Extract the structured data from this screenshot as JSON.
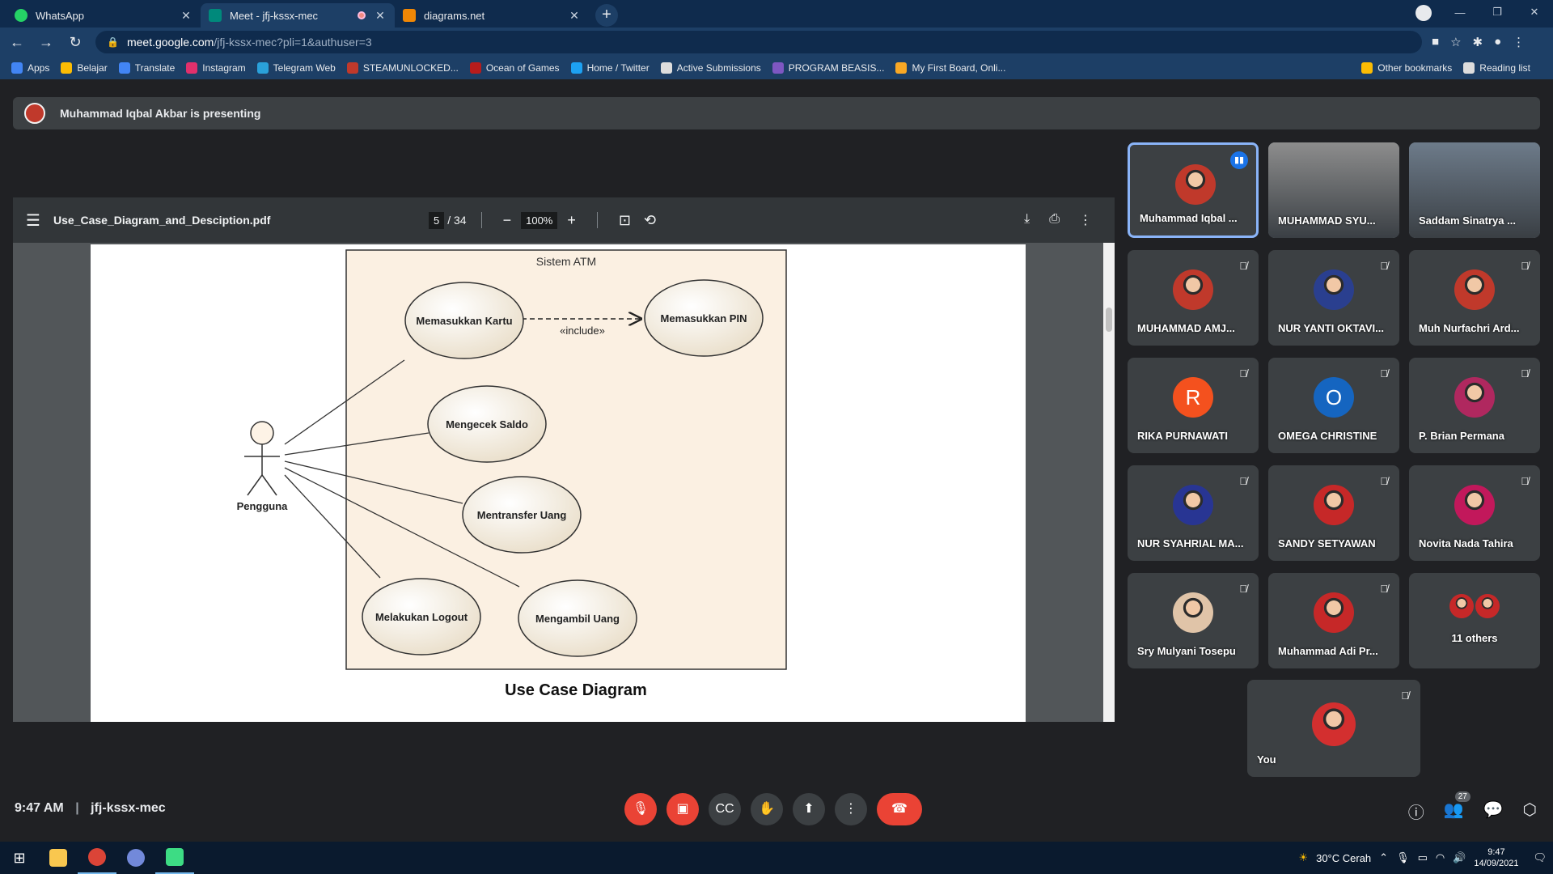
{
  "browser": {
    "tabs": [
      {
        "title": "WhatsApp",
        "color": "#25d366"
      },
      {
        "title": "Meet - jfj-kssx-mec",
        "color": "#00897b"
      },
      {
        "title": "diagrams.net",
        "color": "#f08705"
      }
    ],
    "url_host": "meet.google.com",
    "url_path": "/jfj-kssx-mec?pli=1&authuser=3",
    "bookmarks": [
      {
        "label": "Apps",
        "color": "#4285f4"
      },
      {
        "label": "Belajar",
        "color": "#fbbc04"
      },
      {
        "label": "Translate",
        "color": "#4285f4"
      },
      {
        "label": "Instagram",
        "color": "#e1306c"
      },
      {
        "label": "Telegram Web",
        "color": "#2aa1da"
      },
      {
        "label": "STEAMUNLOCKED...",
        "color": "#c0392b"
      },
      {
        "label": "Ocean of Games",
        "color": "#b71c1c"
      },
      {
        "label": "Home / Twitter",
        "color": "#1da1f2"
      },
      {
        "label": "Active Submissions",
        "color": "#dddddd"
      },
      {
        "label": "PROGRAM BEASIS...",
        "color": "#7e57c2"
      },
      {
        "label": "My First Board, Onli...",
        "color": "#f9a825"
      }
    ],
    "bookmarks_right": [
      {
        "label": "Other bookmarks",
        "color": "#fbbc04"
      },
      {
        "label": "Reading list",
        "color": "#dddddd"
      }
    ]
  },
  "meet": {
    "presenting_text": "Muhammad Iqbal Akbar is presenting",
    "clock": "9:47 AM",
    "meeting_code": "jfj-kssx-mec",
    "participant_count": "27"
  },
  "pdf": {
    "filename": "Use_Case_Diagram_and_Desciption.pdf",
    "page": "5",
    "total_pages": "/ 34",
    "zoom": "100%",
    "diagram": {
      "system_label": "Sistem ATM",
      "actor": "Pengguna",
      "use_cases": {
        "masukkan_kartu": "Memasukkan Kartu",
        "masukkan_pin": "Memasukkan PIN",
        "cek_saldo": "Mengecek Saldo",
        "transfer": "Mentransfer Uang",
        "logout": "Melakukan Logout",
        "ambil_uang": "Mengambil Uang"
      },
      "include_label": "«include»",
      "caption": "Use Case Diagram"
    }
  },
  "participants": [
    {
      "name": "Muhammad Iqbal ...",
      "kind": "photo",
      "color": "#c0392b",
      "speaking": true
    },
    {
      "name": "MUHAMMAD SYU...",
      "kind": "video",
      "color": "#8d8d8d"
    },
    {
      "name": "Saddam Sinatrya ...",
      "kind": "video",
      "color": "#6d7b8a"
    },
    {
      "name": "MUHAMMAD AMJ...",
      "kind": "photo",
      "color": "#c0392b"
    },
    {
      "name": "NUR YANTI OKTAVI...",
      "kind": "photo",
      "color": "#2a3f8f"
    },
    {
      "name": "Muh Nurfachri Ard...",
      "kind": "photo",
      "color": "#c0392b"
    },
    {
      "name": "RIKA PURNAWATI",
      "kind": "letter",
      "letter": "R",
      "color": "#f4511e"
    },
    {
      "name": "OMEGA CHRISTINE",
      "kind": "letter",
      "letter": "O",
      "color": "#1565c0"
    },
    {
      "name": "P. Brian Permana",
      "kind": "photo",
      "color": "#b0285f"
    },
    {
      "name": "NUR SYAHRIAL MA...",
      "kind": "photo",
      "color": "#283593"
    },
    {
      "name": "SANDY SETYAWAN",
      "kind": "photo",
      "color": "#c62828"
    },
    {
      "name": "Novita Nada Tahira",
      "kind": "photo",
      "color": "#c2185b"
    },
    {
      "name": "Sry Mulyani Tosepu",
      "kind": "photo",
      "color": "#e0c4a8"
    },
    {
      "name": "Muhammad Adi Pr...",
      "kind": "photo",
      "color": "#c62828"
    },
    {
      "name": "11 others",
      "kind": "others",
      "color": "#c62828"
    }
  ],
  "self_tile": {
    "name": "You",
    "color": "#d32f2f"
  },
  "taskbar": {
    "weather": "30°C Cerah",
    "time": "9:47",
    "date": "14/09/2021"
  },
  "window_controls": {
    "minimize": "—",
    "restore": "❐",
    "close": "✕"
  }
}
